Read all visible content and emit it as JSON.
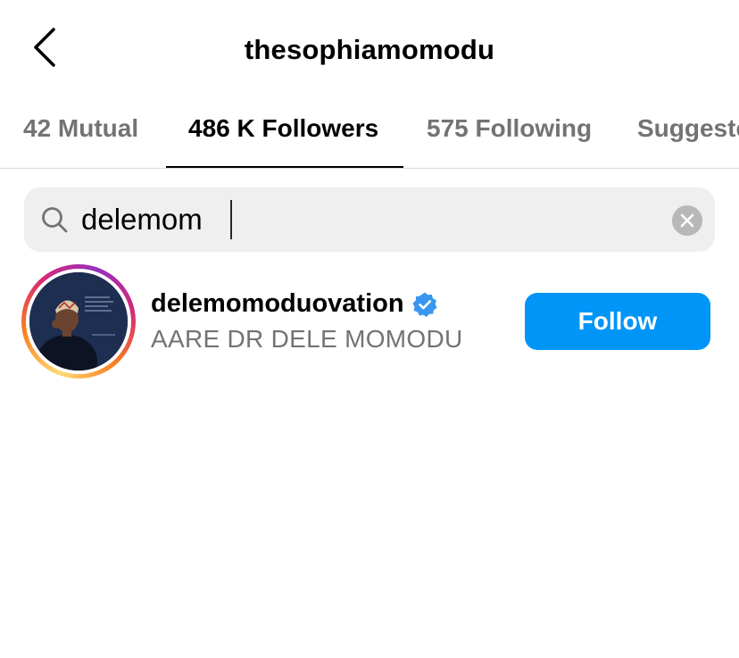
{
  "header": {
    "title": "thesophiamomodu"
  },
  "tabs": [
    {
      "label": "42 Mutual",
      "active": false
    },
    {
      "label": "486 K Followers",
      "active": true
    },
    {
      "label": "575 Following",
      "active": false
    },
    {
      "label": "Suggested",
      "active": false
    }
  ],
  "search": {
    "value": "delemom",
    "placeholder": "Search"
  },
  "results": [
    {
      "username": "delemomoduovation",
      "verified": true,
      "full_name": "AARE DR DELE MOMODU",
      "button_label": "Follow",
      "has_story": true
    }
  ],
  "colors": {
    "accent": "#0095f6",
    "secondary_text": "#737373",
    "search_bg": "#efefef",
    "verified": "#3897f0"
  },
  "icons": {
    "back": "chevron-left-icon",
    "search": "search-icon",
    "clear": "clear-icon",
    "verified": "verified-badge-icon"
  }
}
